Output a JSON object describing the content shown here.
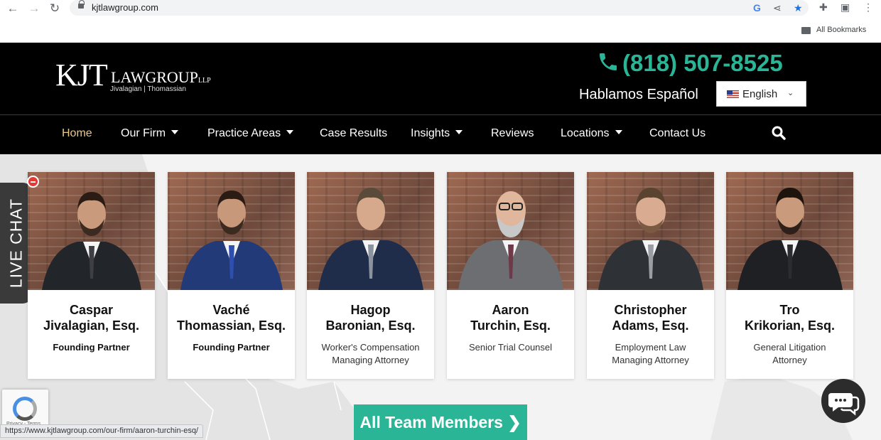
{
  "browser": {
    "url": "kjtlawgroup.com",
    "bookmarks_label": "All Bookmarks",
    "status_url": "https://www.kjtlawgroup.com/our-firm/aaron-turchin-esq/"
  },
  "header": {
    "logo_kjt": "KJT",
    "logo_law": "LAWGROUP",
    "logo_llp": "LLP",
    "logo_sub": "Jivalagian | Thomassian",
    "phone": "(818) 507-8525",
    "hablamos": "Hablamos Español",
    "language": "English",
    "accent_color": "#2bb597"
  },
  "nav": {
    "items": [
      {
        "label": "Home",
        "active": true
      },
      {
        "label": "Our Firm"
      },
      {
        "label": "Practice Areas"
      },
      {
        "label": "Case Results"
      },
      {
        "label": "Insights"
      },
      {
        "label": "Reviews"
      },
      {
        "label": "Locations"
      },
      {
        "label": "Contact Us"
      }
    ]
  },
  "team": [
    {
      "name1": "Caspar",
      "name2": "Jivalagian, Esq.",
      "title1": "Founding Partner",
      "title2": ""
    },
    {
      "name1": "Vaché",
      "name2": "Thomassian, Esq.",
      "title1": "Founding Partner",
      "title2": ""
    },
    {
      "name1": "Hagop",
      "name2": "Baronian, Esq.",
      "title1": "Worker's Compensation",
      "title2": "Managing Attorney"
    },
    {
      "name1": "Aaron",
      "name2": "Turchin, Esq.",
      "title1": "Senior Trial Counsel",
      "title2": ""
    },
    {
      "name1": "Christopher",
      "name2": "Adams, Esq.",
      "title1": "Employment Law",
      "title2": "Managing Attorney"
    },
    {
      "name1": "Tro",
      "name2": "Krikorian, Esq.",
      "title1": "General Litigation",
      "title2": "Attorney"
    }
  ],
  "live_chat": "LIVE CHAT",
  "all_team_button": "All Team Members",
  "recaptcha": "Privacy - Terms"
}
